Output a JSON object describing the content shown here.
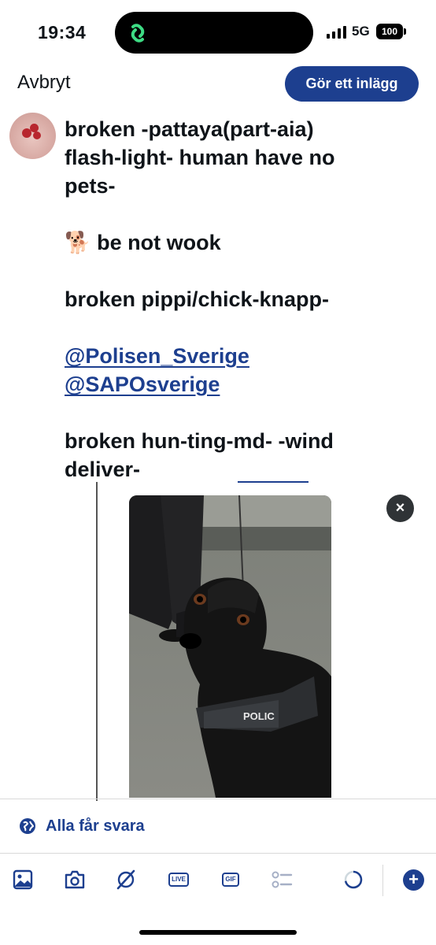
{
  "status_bar": {
    "time": "19:34",
    "network": "5G",
    "battery": "100"
  },
  "header": {
    "cancel_label": "Avbryt",
    "post_label": "Gör ett inlägg"
  },
  "tweet": {
    "lines": [
      "broken -pattaya(part-aia)",
      "flash-light- human have no",
      "pets-",
      "",
      "🐕 be not wook",
      "",
      "broken pippi/chick-knapp-",
      "",
      "@Polisen_Sverige",
      "@SAPOsverige",
      "",
      "broken hun-ting-md- -wind",
      "deliver-"
    ]
  },
  "media": {
    "vest_text": "POLIC",
    "remove_symbol": "×"
  },
  "reply_settings": {
    "label": "Alla får svara",
    "icon": "globe-icon"
  },
  "toolbar": {
    "live_label": "LIVE",
    "gif_label": "GIF",
    "add_symbol": "+"
  },
  "colors": {
    "accent": "#1d3f8f",
    "text": "#0f1419"
  }
}
